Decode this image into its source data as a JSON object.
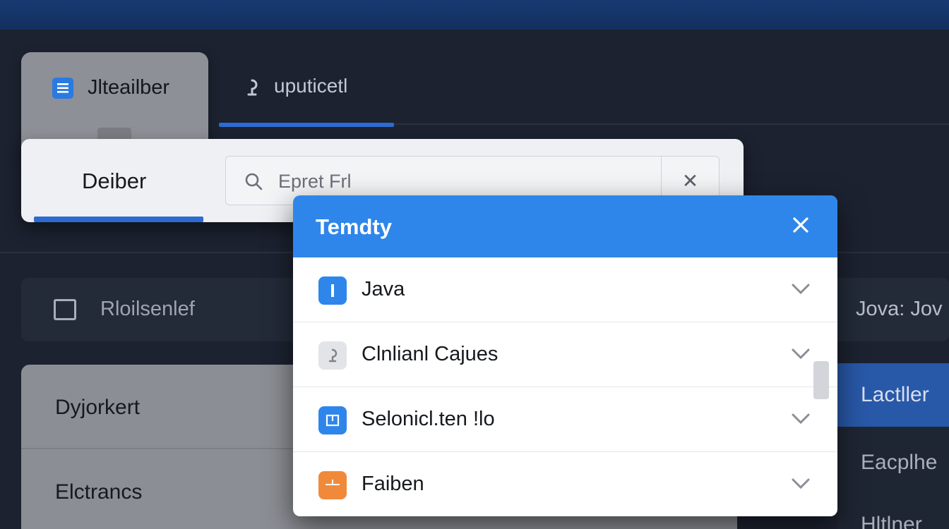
{
  "tabs": [
    {
      "label": "Jlteailber",
      "icon": "document-icon"
    },
    {
      "label": "uputicetl",
      "icon": "link-icon"
    }
  ],
  "search_panel": {
    "title": "Deiber",
    "search_placeholder": "Epret Frl",
    "clear_symbol": "✕"
  },
  "filter": {
    "label": "Rloilsenlef",
    "right_label": "Jova: Jov"
  },
  "left_list": {
    "items": [
      "Dyjorkert",
      "Elctrancs"
    ]
  },
  "right_panel": {
    "items": [
      "Lactller",
      "Eacplhe",
      "Hltlner"
    ]
  },
  "dialog": {
    "title": "Temdty",
    "options": [
      {
        "label": "Java",
        "icon": "info-icon",
        "icon_color": "#2f86ea"
      },
      {
        "label": "Clnlianl Cajues",
        "icon": "link-icon",
        "icon_color": "#e2e4e8"
      },
      {
        "label": "Selonicl.ten !lo",
        "icon": "calendar-icon",
        "icon_color": "#2f86ea"
      },
      {
        "label": "Faiben",
        "icon": "box-icon",
        "icon_color": "#f08a3a"
      }
    ]
  },
  "colors": {
    "accent": "#2f86ea",
    "topbar": "#173a72",
    "background": "#1c2230"
  }
}
